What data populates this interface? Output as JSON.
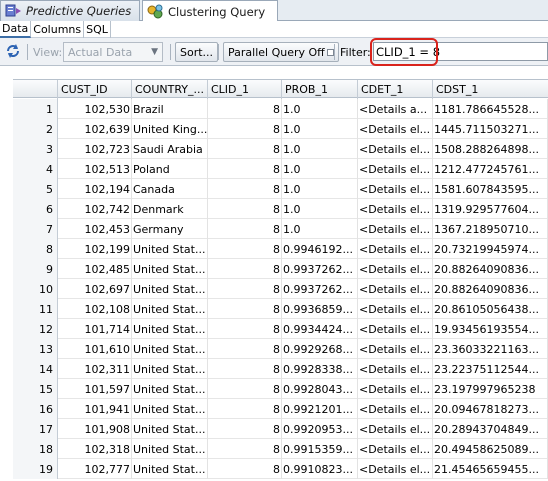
{
  "tabs": [
    {
      "label": "Predictive Queries",
      "icon": "predictive-query-icon",
      "active": false
    },
    {
      "label": "Clustering Query",
      "icon": "clustering-query-icon",
      "active": true
    }
  ],
  "subtabs": [
    {
      "label": "Data",
      "active": true
    },
    {
      "label": "Columns",
      "active": false
    },
    {
      "label": "SQL",
      "active": false
    }
  ],
  "toolbar": {
    "refresh_icon": "refresh-icon",
    "view_label": "View:",
    "view_value": "Actual Data",
    "sort_label": "Sort...",
    "parallel_label": "Parallel Query Off",
    "filter_label": "Filter:",
    "filter_value": "CLID_1 = 8"
  },
  "columns": [
    "CUST_ID",
    "COUNTRY_...",
    "CLID_1",
    "PROB_1",
    "CDET_1",
    "CDST_1"
  ],
  "rows": [
    [
      "1",
      "102,530",
      "Brazil",
      "8",
      "1.0",
      "<Details a...",
      "1181.786645528..."
    ],
    [
      "2",
      "102,639",
      "United King...",
      "8",
      "1.0",
      "<Details el...",
      "1445.711503271..."
    ],
    [
      "3",
      "102,723",
      "Saudi Arabia",
      "8",
      "1.0",
      "<Details el...",
      "1508.288264898..."
    ],
    [
      "4",
      "102,513",
      "Poland",
      "8",
      "1.0",
      "<Details el...",
      "1212.477245761..."
    ],
    [
      "5",
      "102,194",
      "Canada",
      "8",
      "1.0",
      "<Details el...",
      "1581.607843595..."
    ],
    [
      "6",
      "102,742",
      "Denmark",
      "8",
      "1.0",
      "<Details el...",
      "1319.929577604..."
    ],
    [
      "7",
      "102,453",
      "Germany",
      "8",
      "1.0",
      "<Details el...",
      "1367.218950710..."
    ],
    [
      "8",
      "102,199",
      "United Stat...",
      "8",
      "0.9946192...",
      "<Details el...",
      "20.73219945974..."
    ],
    [
      "9",
      "102,485",
      "United Stat...",
      "8",
      "0.9937262...",
      "<Details el...",
      "20.88264090836..."
    ],
    [
      "10",
      "102,697",
      "United Stat...",
      "8",
      "0.9937262...",
      "<Details el...",
      "20.88264090836..."
    ],
    [
      "11",
      "102,108",
      "United Stat...",
      "8",
      "0.9936859...",
      "<Details el...",
      "20.86105056438..."
    ],
    [
      "12",
      "101,714",
      "United Stat...",
      "8",
      "0.9934424...",
      "<Details el...",
      "19.93456193554..."
    ],
    [
      "13",
      "101,610",
      "United Stat...",
      "8",
      "0.9929268...",
      "<Details el...",
      "23.36033221163..."
    ],
    [
      "14",
      "102,311",
      "United Stat...",
      "8",
      "0.9928338...",
      "<Details el...",
      "23.22375112544..."
    ],
    [
      "15",
      "101,597",
      "United Stat...",
      "8",
      "0.9928043...",
      "<Details el...",
      "23.197997965238"
    ],
    [
      "16",
      "101,941",
      "United Stat...",
      "8",
      "0.9921201...",
      "<Details el...",
      "20.09467818273..."
    ],
    [
      "17",
      "101,908",
      "United Stat...",
      "8",
      "0.9920953...",
      "<Details el...",
      "20.28943704849..."
    ],
    [
      "18",
      "102,318",
      "United Stat...",
      "8",
      "0.9915359...",
      "<Details el...",
      "20.49458625089..."
    ],
    [
      "19",
      "102,777",
      "United Stat...",
      "8",
      "0.9910823...",
      "<Details el...",
      "21.45465659455..."
    ]
  ]
}
